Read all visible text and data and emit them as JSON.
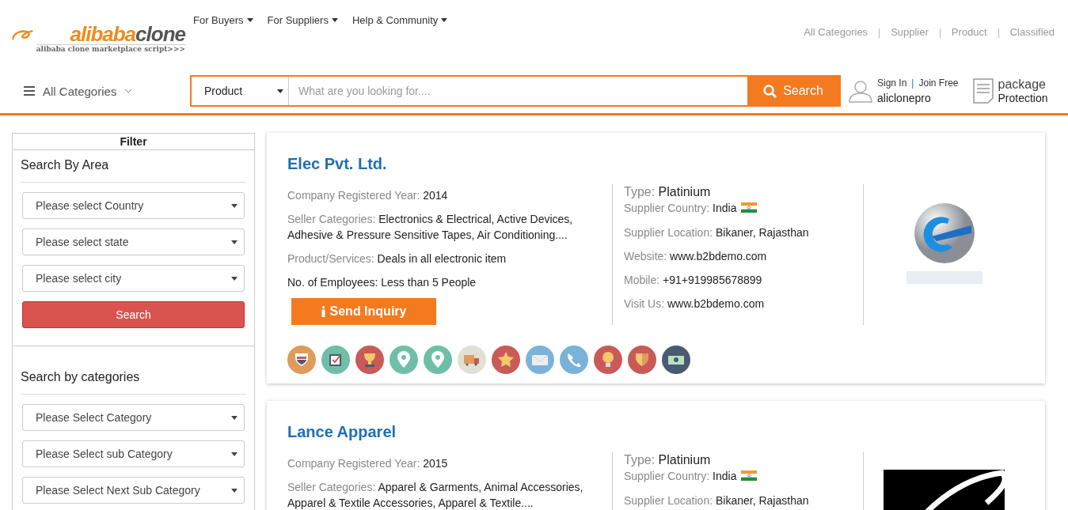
{
  "header": {
    "logo": {
      "part_1": "alibaba",
      "part_2": "clone",
      "tagline": "alibaba clone marketplace script>>>"
    },
    "top_nav": [
      {
        "label": "For Buyers"
      },
      {
        "label": "For Suppliers"
      },
      {
        "label": "Help & Community"
      }
    ],
    "quick_links": [
      "All Categories",
      "Supplier",
      "Product",
      "Classified"
    ],
    "categories_menu": {
      "label": "All Categories"
    },
    "search": {
      "type_select": "Product",
      "placeholder": "What are you looking for....",
      "button": "Search"
    },
    "account": {
      "sign_in": "Sign In",
      "separator": "|",
      "join": "Join Free",
      "username": "aliclonepro"
    },
    "package": {
      "line_1": "package",
      "line_2": "Protection"
    }
  },
  "filter": {
    "title": "Filter",
    "sections": [
      {
        "title": "Search By Area",
        "selects": [
          "Please select Country",
          "Please select state",
          "Please select city"
        ],
        "button": "Search"
      },
      {
        "title": "Search by categories",
        "selects": [
          "Please Select Category",
          "Please Select sub Category",
          "Please Select Next Sub Category"
        ]
      }
    ]
  },
  "companies": [
    {
      "name": "Elec Pvt. Ltd.",
      "logo": {
        "kind": "sphere"
      },
      "details": [
        {
          "kind": "plain",
          "label": "Company Registered Year:",
          "value": "2014"
        },
        {
          "kind": "plain",
          "label": "Seller Categories:",
          "value": "Electronics & Electrical, Active Devices, Adhesive & Pressure Sensitive Tapes, Air Conditioning...."
        },
        {
          "kind": "plain",
          "label": "Product/Services:",
          "value": "Deals in all electronic item"
        },
        {
          "kind": "dark",
          "label": "No. of Employees:",
          "value": "Less than 5 People"
        }
      ],
      "inquiry_button": "Send Inquiry",
      "supplier": [
        {
          "kind": "type",
          "label": "Type:",
          "value": "Platinium"
        },
        {
          "kind": "country",
          "label": "Supplier Country:",
          "value": "India"
        },
        {
          "kind": "plain",
          "label": "Supplier Location:",
          "value": "Bikaner, Rajasthan"
        },
        {
          "kind": "plain",
          "label": "Website:",
          "value": "www.b2bdemo.com"
        },
        {
          "kind": "plain",
          "label": "Mobile:",
          "value": "+91+919985678899"
        },
        {
          "kind": "plain",
          "label": "Visit Us:",
          "value": "www.b2bdemo.com"
        }
      ]
    },
    {
      "name": "Lance Apparel",
      "logo": {
        "kind": "script"
      },
      "details": [
        {
          "kind": "plain",
          "label": "Company Registered Year:",
          "value": "2015"
        },
        {
          "kind": "plain",
          "label": "Seller Categories:",
          "value": "Apparel & Garments, Animal Accessories, Apparel & Textile Accessories, Apparel & Textile...."
        }
      ],
      "supplier": [
        {
          "kind": "type",
          "label": "Type:",
          "value": "Platinium"
        },
        {
          "kind": "country",
          "label": "Supplier Country:",
          "value": "India"
        },
        {
          "kind": "plain",
          "label": "Supplier Location:",
          "value": "Bikaner, Rajasthan"
        }
      ]
    }
  ]
}
